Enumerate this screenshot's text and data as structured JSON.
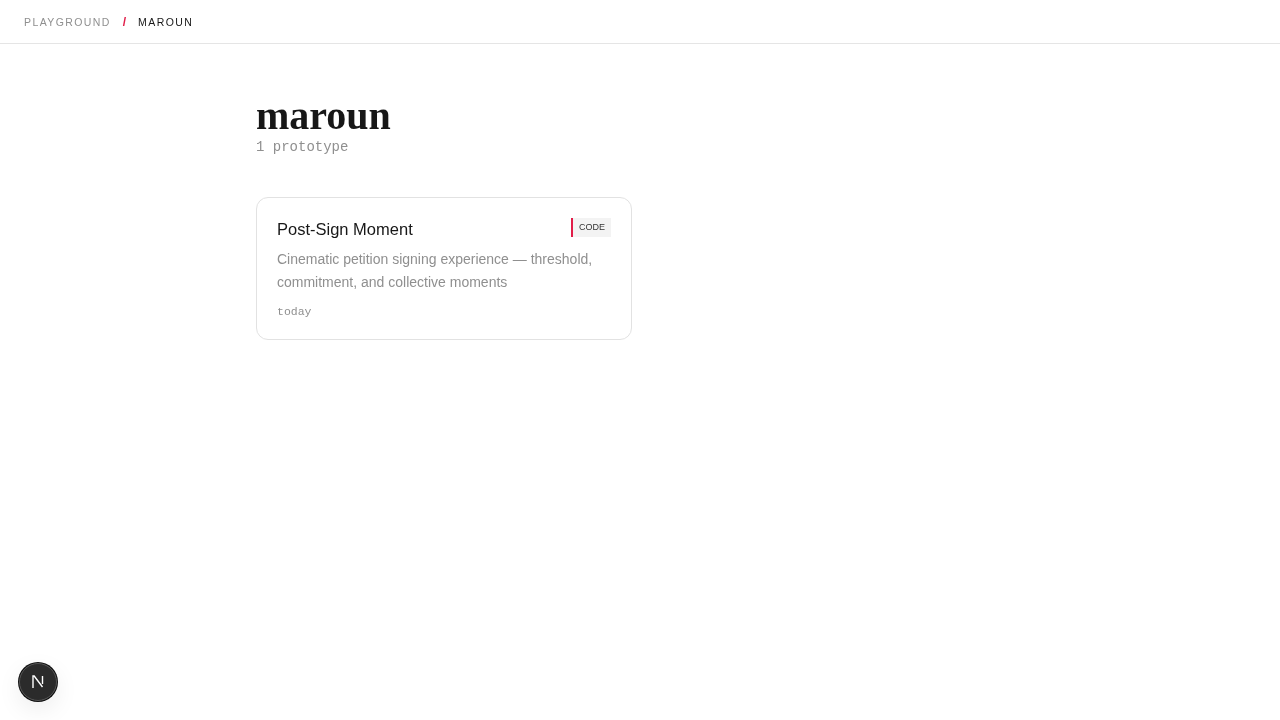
{
  "breadcrumb": {
    "items": [
      {
        "label": "PLAYGROUND"
      },
      {
        "label": "MAROUN"
      }
    ],
    "separator": "/"
  },
  "page": {
    "title": "maroun",
    "count": "1 prototype"
  },
  "cards": [
    {
      "title": "Post-Sign Moment",
      "badge": "CODE",
      "description": "Cinematic petition signing experience — threshold, commitment, and collective moments",
      "date": "today"
    }
  ]
}
